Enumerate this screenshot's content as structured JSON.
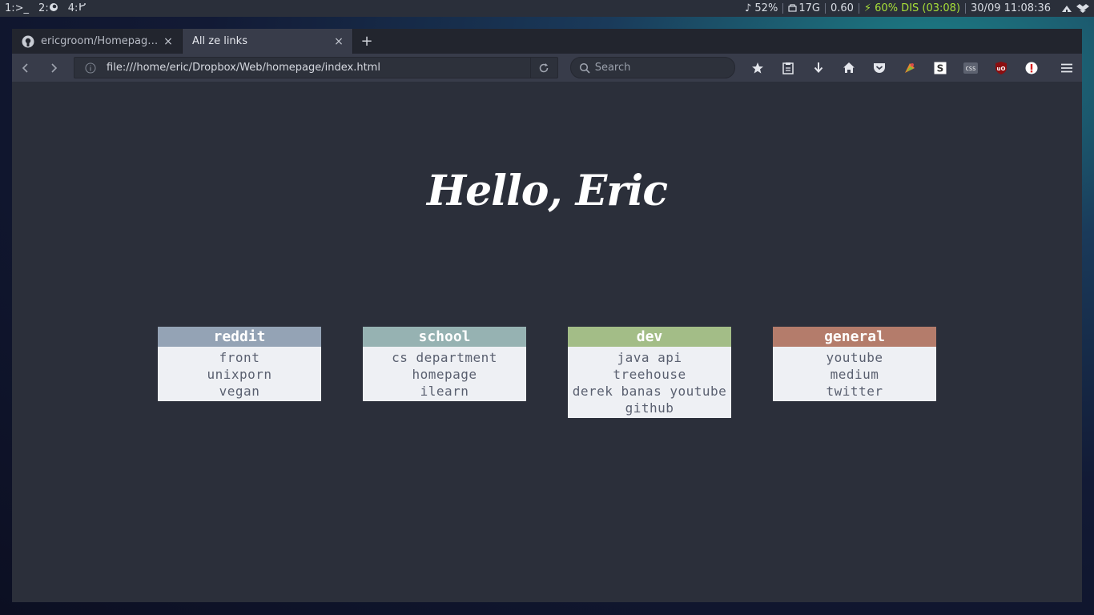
{
  "sysbar": {
    "workspaces": [
      "1:>_",
      "2:",
      "4:"
    ],
    "stats": [
      "♪ 52%",
      "17G",
      "0.60",
      "⚡ 60% DIS (03:08)",
      "30/09 11:08:36"
    ]
  },
  "browser": {
    "tabs": [
      {
        "title": "ericgroom/Homepag…",
        "close": "×",
        "active": false
      },
      {
        "title": "All ze links",
        "close": "×",
        "active": true
      }
    ],
    "new_tab": "+",
    "url": "file:///home/eric/Dropbox/Web/homepage/index.html",
    "search_placeholder": "Search"
  },
  "page": {
    "greeting": "Hello, Eric",
    "categories": [
      {
        "title": "reddit",
        "color": "#94a3b5",
        "links": [
          "front",
          "unixporn",
          "vegan"
        ]
      },
      {
        "title": "school",
        "color": "#96b2b2",
        "links": [
          "cs department",
          "homepage",
          "ilearn"
        ]
      },
      {
        "title": "dev",
        "color": "#a3bd87",
        "links": [
          "java api",
          "treehouse",
          "derek banas youtube",
          "github"
        ]
      },
      {
        "title": "general",
        "color": "#b47c6b",
        "links": [
          "youtube",
          "medium",
          "twitter"
        ]
      }
    ]
  }
}
